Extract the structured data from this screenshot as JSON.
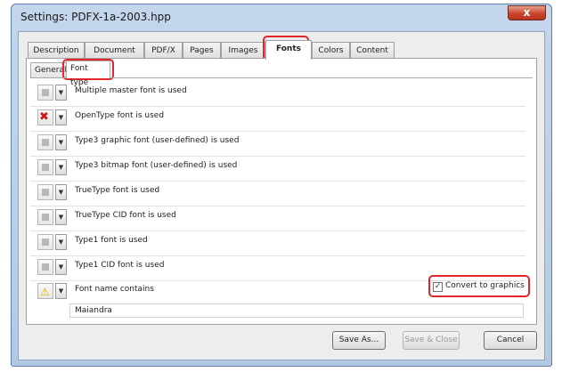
{
  "window": {
    "title": "Settings: PDFX-1a-2003.hpp",
    "close_glyph": "x"
  },
  "tabs": [
    {
      "label": "Description"
    },
    {
      "label": "Document"
    },
    {
      "label": "PDF/X"
    },
    {
      "label": "Pages"
    },
    {
      "label": "Images"
    },
    {
      "label": "Fonts",
      "active": true
    },
    {
      "label": "Colors"
    },
    {
      "label": "Content"
    }
  ],
  "subtabs": [
    {
      "label": "General"
    },
    {
      "label": "Font type",
      "active": true
    }
  ],
  "rows": [
    {
      "label": "Multiple master font is used",
      "state": "neutral"
    },
    {
      "label": "OpenType font is used",
      "state": "error"
    },
    {
      "label": "Type3 graphic font (user-defined) is used",
      "state": "neutral"
    },
    {
      "label": "Type3 bitmap font (user-defined) is used",
      "state": "neutral"
    },
    {
      "label": "TrueType font is used",
      "state": "neutral"
    },
    {
      "label": "TrueType CID font is used",
      "state": "neutral"
    },
    {
      "label": "Type1 font is used",
      "state": "neutral"
    },
    {
      "label": "Type1 CID font is used",
      "state": "neutral"
    },
    {
      "label": "Font name contains",
      "state": "warning"
    }
  ],
  "state_glyphs": {
    "error": "✖",
    "warning": "⚠",
    "dropdown": "▼",
    "check": "✓"
  },
  "font_name_value": "Maiandra",
  "convert": {
    "label": "Convert to graphics",
    "checked": true
  },
  "buttons": {
    "save_as": "Save As...",
    "save_close": "Save & Close",
    "cancel": "Cancel"
  },
  "colors": {
    "highlight": "#e2262d",
    "error_icon": "#d01818",
    "warning_icon": "#e0b000"
  }
}
